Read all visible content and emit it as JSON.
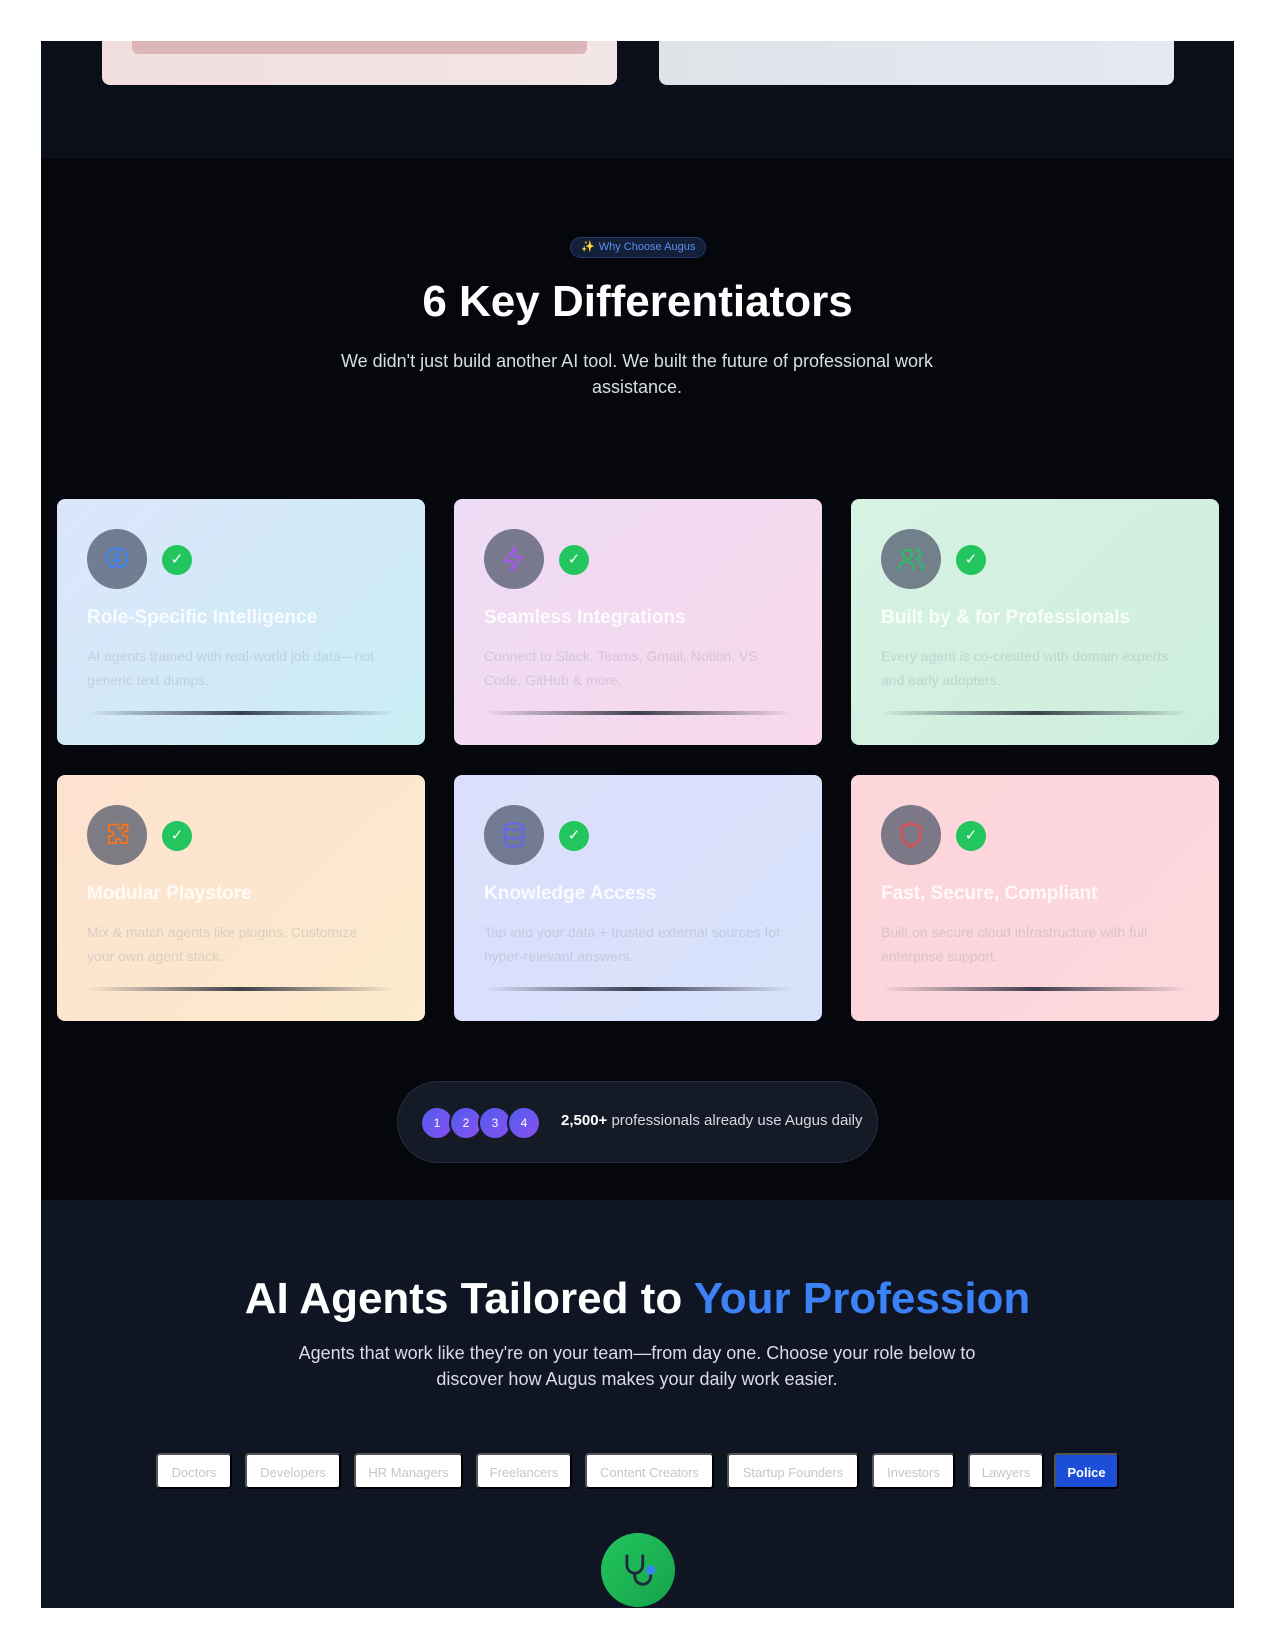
{
  "differentiators": {
    "badge_icon": "sparkles-icon",
    "badge_text": "Why Choose Augus",
    "title": "6 Key Differentiators",
    "subtitle": "We didn't just build another AI tool. We built the future of professional work assistance.",
    "check_symbol": "✓",
    "cards": [
      {
        "icon": "brain-icon",
        "title": "Role-Specific Intelligence",
        "description": "AI agents trained with real-world job data—not generic text dumps.",
        "accent": "#3b82f6"
      },
      {
        "icon": "zap-icon",
        "title": "Seamless Integrations",
        "description": "Connect to Slack, Teams, Gmail, Notion, VS Code, GitHub & more.",
        "accent": "#a855f7"
      },
      {
        "icon": "users-icon",
        "title": "Built by & for Professionals",
        "description": "Every agent is co-created with domain experts and early adopters.",
        "accent": "#22c55e"
      },
      {
        "icon": "puzzle-icon",
        "title": "Modular Playstore",
        "description": "Mix & match agents like plugins. Customize your own agent stack.",
        "accent": "#f97316"
      },
      {
        "icon": "database-icon",
        "title": "Knowledge Access",
        "description": "Tap into your data + trusted external sources for hyper-relevant answers.",
        "accent": "#6366f1"
      },
      {
        "icon": "shield-icon",
        "title": "Fast, Secure, Compliant",
        "description": "Built on secure cloud infrastructure with full enterprise support.",
        "accent": "#ef4444"
      }
    ],
    "social_proof": {
      "avatars": [
        "1",
        "2",
        "3",
        "4"
      ],
      "count": "2,500+",
      "text": "professionals already use Augus daily"
    }
  },
  "professions": {
    "title_main": "AI Agents Tailored to ",
    "title_accent": "Your Profession",
    "subtitle": "Agents that work like they're on your team—from day one. Choose your role below to discover how Augus makes your daily work easier.",
    "roles": [
      "Doctors",
      "Developers",
      "HR Managers",
      "Freelancers",
      "Content Creators",
      "Startup Founders",
      "Investors",
      "Lawyers",
      "Police"
    ],
    "active_role": "Police",
    "featured_icon": "stethoscope-icon",
    "accent_color": "#3b82f6",
    "active_color": "#1d4ed8"
  }
}
